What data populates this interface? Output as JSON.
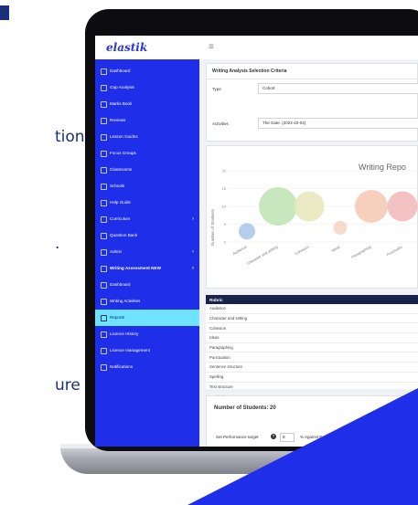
{
  "background_text": [
    "tions.",
    ".",
    "ure"
  ],
  "app": {
    "logo_text": "elastik",
    "sidebar": [
      {
        "label": "Dashboard",
        "icon": "dashboard-icon"
      },
      {
        "label": "Gap Analysis",
        "icon": "gap-analysis-icon"
      },
      {
        "label": "Marks Book",
        "icon": "marks-book-icon"
      },
      {
        "label": "Reviews",
        "icon": "reviews-icon"
      },
      {
        "label": "Lesson Guides",
        "icon": "lesson-guides-icon"
      },
      {
        "label": "Focus Groups",
        "icon": "focus-groups-icon"
      },
      {
        "label": "Classrooms",
        "icon": "classrooms-icon"
      },
      {
        "label": "Schools",
        "icon": "schools-icon"
      },
      {
        "label": "Help Guide",
        "icon": "help-guide-icon"
      },
      {
        "label": "Curriculum",
        "icon": "curriculum-icon",
        "chevron": "›"
      },
      {
        "label": "Question Bank",
        "icon": "question-bank-icon"
      },
      {
        "label": "Admin",
        "icon": "admin-icon",
        "chevron": "›"
      },
      {
        "label": "Writing Assessment NEW",
        "icon": "writing-assessment-icon",
        "chevron": "›",
        "bold": true
      },
      {
        "label": "Dashboard",
        "icon": "dashboard-icon"
      },
      {
        "label": "Writing Activities",
        "icon": "writing-activities-icon"
      },
      {
        "label": "Reports",
        "icon": "reports-icon",
        "active": true
      },
      {
        "label": "Licence History",
        "icon": "licence-history-icon"
      },
      {
        "label": "Licence management",
        "icon": "licence-management-icon"
      },
      {
        "label": "Notifications",
        "icon": "notifications-icon"
      }
    ],
    "criteria": {
      "title": "Writing Analysis Selection Criteria",
      "type_label": "Type",
      "type_value": "Cohort",
      "activities_label": "Activities",
      "activities_value": "The Gate. (2022-10-04)"
    },
    "table": {
      "header": "Rubric",
      "rows": [
        "Audience",
        "Character and setting",
        "Cohesion",
        "Ideas",
        "Paragraphing",
        "Punctuation",
        "Sentence structure",
        "Spelling",
        "Text structure",
        "Vocabulary"
      ]
    },
    "students": {
      "title": "Number of Students: 20",
      "perf_label": "Set Performance target",
      "target_value": "0",
      "against_label": "% Against Benc"
    }
  },
  "chart_data": {
    "type": "scatter",
    "title": "Writing Repo",
    "ylabel": "Number of Students",
    "yticks": [
      0,
      5,
      10,
      15,
      20
    ],
    "ylim": [
      0,
      20
    ],
    "categories": [
      "Audience",
      "Character and setting",
      "Cohesion",
      "Ideas",
      "Paragraphing",
      "Punctuatio"
    ],
    "points": [
      {
        "category": "Audience",
        "y": 3,
        "size": 6,
        "color": "#a9c6ea"
      },
      {
        "category": "Character and setting",
        "y": 10,
        "size": 14,
        "color": "#bfe3b4"
      },
      {
        "category": "Cohesion",
        "y": 10,
        "size": 11,
        "color": "#e6e6b9"
      },
      {
        "category": "Ideas",
        "y": 4,
        "size": 5,
        "color": "#f5d5c4"
      },
      {
        "category": "Paragraphing",
        "y": 10,
        "size": 12,
        "color": "#f6c7b1"
      },
      {
        "category": "Punctuatio",
        "y": 10,
        "size": 11,
        "color": "#f1b9b9"
      }
    ],
    "grid": true
  },
  "colors": {
    "sidebar": "#1f2ee8",
    "active_item": "#6fe3ff",
    "table_header": "#17234a",
    "wedge": "#1f2ee8"
  }
}
